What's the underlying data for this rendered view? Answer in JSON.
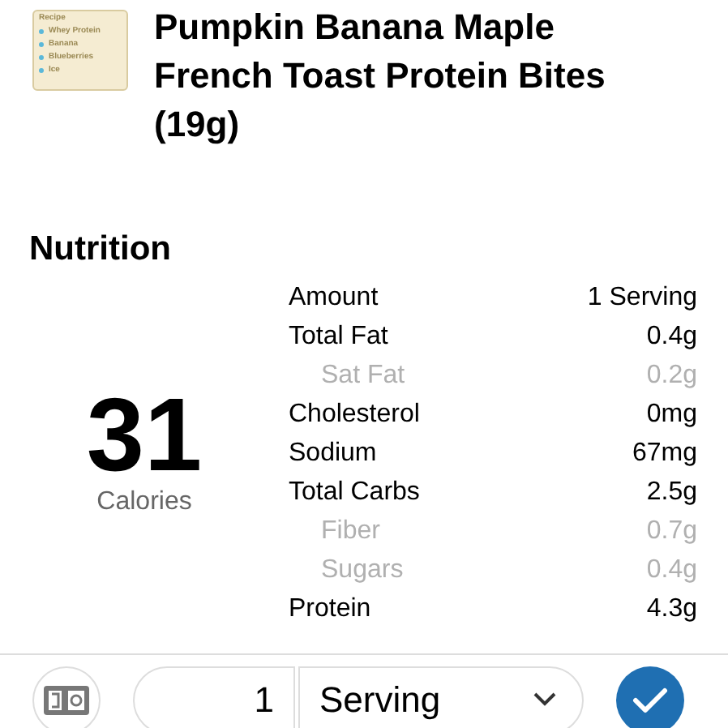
{
  "recipe_card": {
    "title": "Recipe",
    "ingredients": [
      "Whey Protein",
      "Banana",
      "Blueberries",
      "Ice"
    ]
  },
  "title": "Pumpkin Banana Maple French Toast Protein Bites (19g)",
  "section_heading": "Nutrition",
  "calories": {
    "value": "31",
    "label": "Calories"
  },
  "nutrition_rows": [
    {
      "kind": "header",
      "name": "Amount",
      "value": "1 Serving"
    },
    {
      "kind": "main",
      "name": "Total Fat",
      "value": "0.4g"
    },
    {
      "kind": "sub",
      "name": "Sat Fat",
      "value": "0.2g"
    },
    {
      "kind": "main",
      "name": "Cholesterol",
      "value": "0mg"
    },
    {
      "kind": "main",
      "name": "Sodium",
      "value": "67mg"
    },
    {
      "kind": "main",
      "name": "Total Carbs",
      "value": "2.5g"
    },
    {
      "kind": "sub",
      "name": "Fiber",
      "value": "0.7g"
    },
    {
      "kind": "sub",
      "name": "Sugars",
      "value": "0.4g"
    },
    {
      "kind": "main",
      "name": "Protein",
      "value": "4.3g"
    }
  ],
  "bottom_bar": {
    "quantity": "1",
    "unit": "Serving"
  }
}
